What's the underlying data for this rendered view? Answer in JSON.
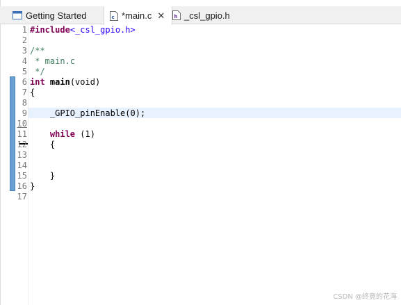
{
  "tabs": [
    {
      "label": "Getting Started",
      "icon": "welcome-page-icon",
      "active": false
    },
    {
      "label": "*main.c",
      "icon": "c-file-icon",
      "active": true,
      "close": "✕"
    },
    {
      "label": "_csl_gpio.h",
      "icon": "h-file-icon",
      "active": false
    }
  ],
  "editor": {
    "lines": [
      {
        "num": "1",
        "text": "#include<_csl_gpio.h>"
      },
      {
        "num": "2",
        "text": ""
      },
      {
        "num": "3",
        "text": "/**"
      },
      {
        "num": "4",
        "text": " * main.c"
      },
      {
        "num": "5",
        "text": " */"
      },
      {
        "num": "6",
        "text": "int main(void)"
      },
      {
        "num": "7",
        "text": "{"
      },
      {
        "num": "8",
        "text": ""
      },
      {
        "num": "9",
        "text": "    _GPIO_pinEnable(0);"
      },
      {
        "num": "10",
        "text": ""
      },
      {
        "num": "11",
        "text": "    while (1)"
      },
      {
        "num": "12",
        "text": "    {"
      },
      {
        "num": "13",
        "text": ""
      },
      {
        "num": "14",
        "text": ""
      },
      {
        "num": "15",
        "text": "    }"
      },
      {
        "num": "16",
        "text": "}"
      },
      {
        "num": "17",
        "text": ""
      }
    ],
    "tokens": {
      "include_directive": "#include",
      "include_file": "<_csl_gpio.h>",
      "int_keyword": "int",
      "main_name": "main",
      "main_params": "(void)",
      "call_indent": "    ",
      "call_text": "_GPIO_pinEnable(0);",
      "while_indent": "    ",
      "while_keyword": "while",
      "while_cond": " (1)",
      "open_brace_inner": "    {",
      "close_brace_inner": "    }",
      "open_brace": "{",
      "close_brace": "}",
      "comment_open": "/**",
      "comment_body": " * main.c",
      "comment_close": " */"
    }
  },
  "watermark": "CSDN @终竟的花海",
  "colors": {
    "keyword": "#7f0055",
    "string": "#2a00ff",
    "comment": "#3f7f5f",
    "current_line": "#e8f2fe",
    "change_ruler": "#6a9fd4"
  }
}
